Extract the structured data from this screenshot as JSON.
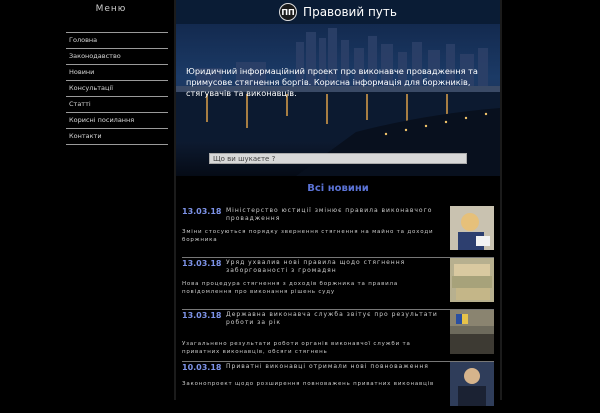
{
  "sidebar": {
    "title": "Меню",
    "items": [
      {
        "label": "Головна"
      },
      {
        "label": "Законодавство"
      },
      {
        "label": "Новини"
      },
      {
        "label": "Консультації"
      },
      {
        "label": "Статті"
      },
      {
        "label": "Корисні посилання"
      },
      {
        "label": "Контакти"
      }
    ]
  },
  "header": {
    "logo_text": "ПП",
    "site_title": "Правовий путь"
  },
  "hero": {
    "description": "Юридичний інформаційний проект про виконавче провадження та примусове стягнення боргів. Корисна інформація для боржників, стягувачів та виконавців."
  },
  "search": {
    "placeholder": "Що ви шукаєте ?"
  },
  "news": {
    "heading": "Всі новини",
    "items": [
      {
        "date": "13.03.18",
        "headline": "Міністерство юстиції змінює правила виконавчого провадження",
        "summary": "Зміни стосуються порядку звернення стягнення на майно та доходи боржника"
      },
      {
        "date": "13.03.18",
        "headline": "Уряд ухвалив нові правила щодо стягнення заборгованості з громадян",
        "summary": "Нова процедура стягнення з доходів боржника та правила повідомлення про виконання рішень суду"
      },
      {
        "date": "13.03.18",
        "headline": "Державна виконавча служба звітує про результати роботи за рік",
        "summary": "Узагальнено результати роботи органів виконавчої служби та приватних виконавців, обсяги стягнень"
      },
      {
        "date": "10.03.18",
        "headline": "Приватні виконавці отримали нові повноваження",
        "summary": "Законопроект щодо розширення повноважень приватних виконавців"
      }
    ]
  },
  "colors": {
    "accent": "#5b73d6",
    "date": "#7d93e8",
    "topbar": "#0a1c35"
  }
}
